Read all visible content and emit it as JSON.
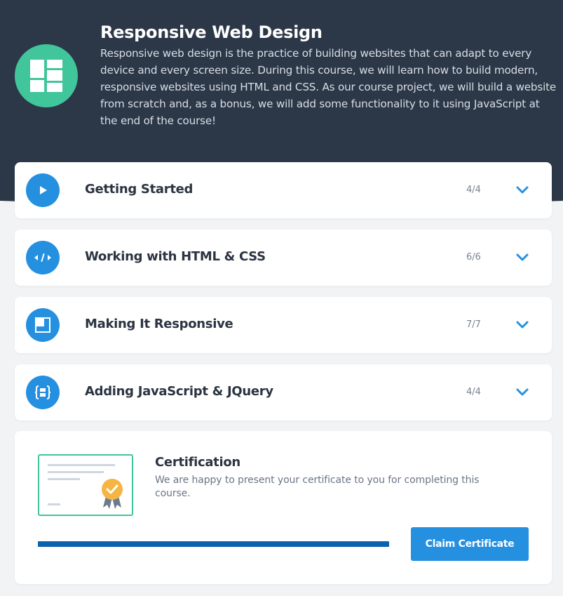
{
  "course": {
    "title": "Responsive Web Design",
    "description": "Responsive web design is the practice of building websites that can adapt to every device and every screen size. During this course, we will learn how to build modern, responsive websites using HTML and CSS. As our course project, we will build a website from scratch and, as a bonus, we will add some functionality to it using JavaScript at the end of the course!",
    "logo_icon": "layout-grid-icon"
  },
  "sections": [
    {
      "title": "Getting Started",
      "progress": "4/4",
      "icon": "play-icon"
    },
    {
      "title": "Working with HTML & CSS",
      "progress": "6/6",
      "icon": "code-icon"
    },
    {
      "title": "Making It Responsive",
      "progress": "7/7",
      "icon": "responsive-layout-icon"
    },
    {
      "title": "Adding JavaScript & JQuery",
      "progress": "4/4",
      "icon": "javascript-braces-icon"
    }
  ],
  "certification": {
    "title": "Certification",
    "text": "We are happy to present your certificate to you for completing this course.",
    "button_label": "Claim Certificate",
    "progress_fraction": 1.0
  },
  "colors": {
    "header_bg": "#2c3747",
    "brand_green": "#41c59b",
    "accent_blue": "#2590e0",
    "progress_blue": "#0b63ad",
    "page_bg": "#f2f3f5"
  }
}
